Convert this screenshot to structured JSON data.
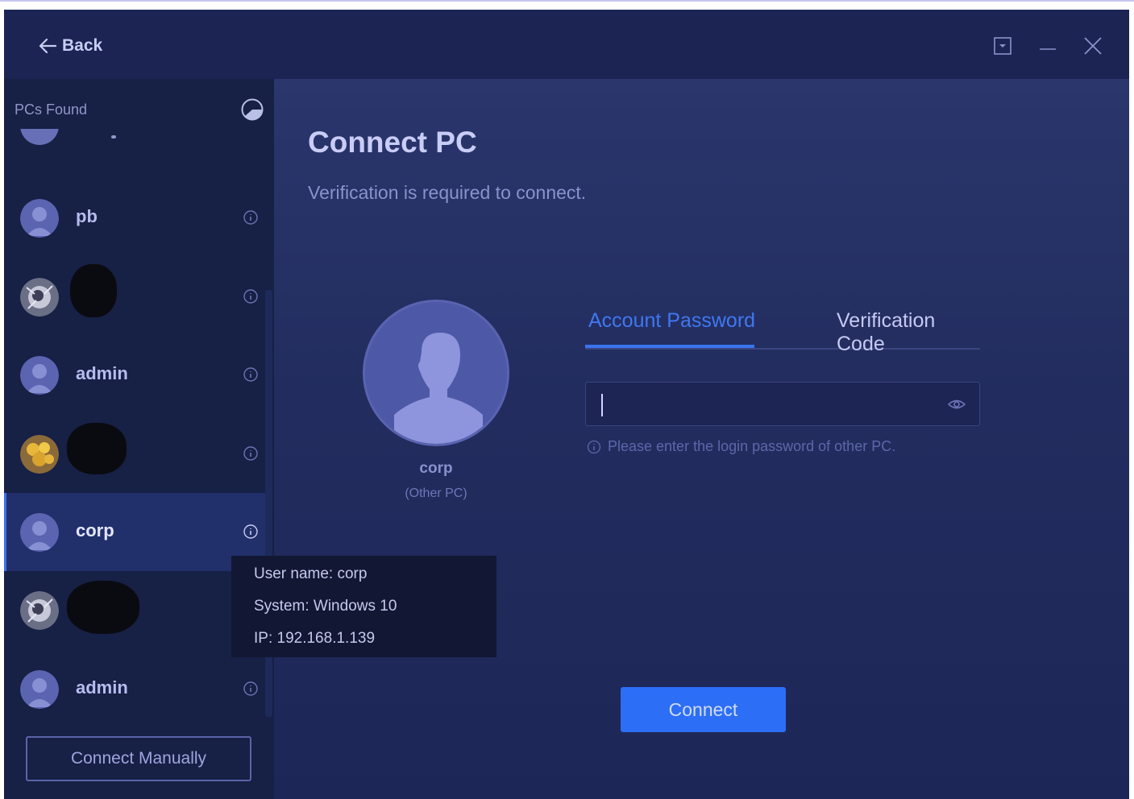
{
  "titlebar": {
    "back_label": "Back"
  },
  "sidebar": {
    "title": "PCs Found",
    "items": [
      {
        "name": "pb",
        "avatar": "default"
      },
      {
        "name": "",
        "avatar": "photo"
      },
      {
        "name": "admin",
        "avatar": "default"
      },
      {
        "name": "",
        "avatar": "photo"
      },
      {
        "name": "corp",
        "avatar": "default",
        "selected": true
      },
      {
        "name": "",
        "avatar": "photo"
      },
      {
        "name": "admin",
        "avatar": "default"
      }
    ],
    "connect_manually_label": "Connect Manually"
  },
  "main": {
    "title": "Connect PC",
    "subtitle": "Verification is required to connect.",
    "pc_name": "corp",
    "pc_sub": "(Other PC)",
    "tabs": [
      {
        "label": "Account Password",
        "active": true
      },
      {
        "label": "Verification Code",
        "active": false
      }
    ],
    "password_value": "",
    "hint": "Please enter the login password of other PC.",
    "connect_label": "Connect"
  },
  "tooltip": {
    "username": "User name: corp",
    "system": "System: Windows 10",
    "ip": "IP: 192.168.1.139"
  },
  "colors": {
    "accent": "#2c6ef6",
    "tab_active": "#3f78f0",
    "background": "#1a2452"
  }
}
